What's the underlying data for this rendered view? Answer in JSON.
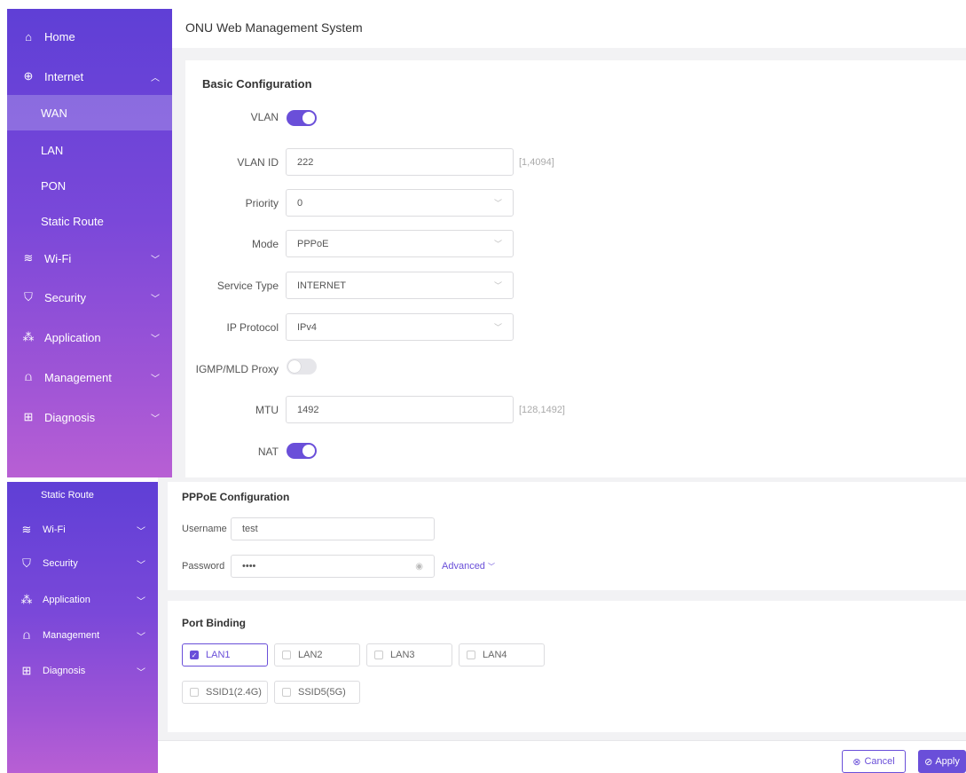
{
  "app": {
    "title": "ONU Web Management System"
  },
  "sidebar": {
    "home": {
      "label": "Home",
      "icon": "home-icon"
    },
    "internet": {
      "label": "Internet",
      "icon": "globe-icon"
    },
    "sub": [
      "WAN",
      "LAN",
      "PON",
      "Static Route"
    ],
    "groups": [
      {
        "label": "Wi-Fi",
        "icon": "wifi-icon"
      },
      {
        "label": "Security",
        "icon": "shield-icon"
      },
      {
        "label": "Application",
        "icon": "apps-icon"
      },
      {
        "label": "Management",
        "icon": "router-icon"
      },
      {
        "label": "Diagnosis",
        "icon": "diagnosis-icon"
      }
    ]
  },
  "basic": {
    "title": "Basic Configuration",
    "vlan_label": "VLAN",
    "vlan_id_label": "VLAN ID",
    "vlan_id_value": "222",
    "vlan_id_hint": "[1,4094]",
    "priority_label": "Priority",
    "priority_value": "0",
    "mode_label": "Mode",
    "mode_value": "PPPoE",
    "service_label": "Service Type",
    "service_value": "INTERNET",
    "ip_label": "IP Protocol",
    "ip_value": "IPv4",
    "igmp_label": "IGMP/MLD Proxy",
    "mtu_label": "MTU",
    "mtu_value": "1492",
    "mtu_hint": "[128,1492]",
    "nat_label": "NAT"
  },
  "toggles": {
    "vlan": true,
    "igmp": false,
    "nat": true
  },
  "pppoe": {
    "title": "PPPoE Configuration",
    "username_label": "Username",
    "username_value": "test",
    "password_label": "Password",
    "password_value": "••••",
    "advanced": "Advanced"
  },
  "port_binding": {
    "title": "Port Binding",
    "ports": [
      {
        "label": "LAN1",
        "checked": true
      },
      {
        "label": "LAN2",
        "checked": false
      },
      {
        "label": "LAN3",
        "checked": false
      },
      {
        "label": "LAN4",
        "checked": false
      },
      {
        "label": "SSID1(2.4G)",
        "checked": false
      },
      {
        "label": "SSID5(5G)",
        "checked": false
      }
    ]
  },
  "actions": {
    "cancel": "Cancel",
    "apply": "Apply"
  },
  "colors": {
    "accent": "#6a4fd9"
  }
}
